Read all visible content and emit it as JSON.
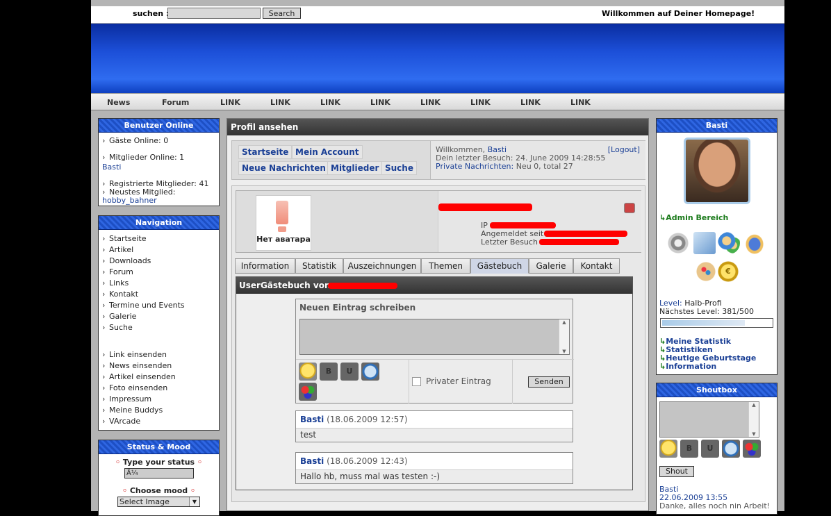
{
  "search": {
    "label": "suchen :",
    "button": "Search"
  },
  "welcome": "Willkommen auf Deiner Homepage!",
  "topnav": [
    "News",
    "Forum",
    "LINK",
    "LINK",
    "LINK",
    "LINK",
    "LINK",
    "LINK",
    "LINK",
    "LINK"
  ],
  "online": {
    "title": "Benutzer Online",
    "guests": "Gäste Online: 0",
    "members": "Mitglieder Online: 1",
    "member_name": "Basti",
    "registered": "Registrierte Mitglieder: 41",
    "newest": "Neustes Mitglied:",
    "newest_name": "hobby_bahner"
  },
  "navigation": {
    "title": "Navigation",
    "items": [
      "Startseite",
      "Artikel",
      "Downloads",
      "Forum",
      "Links",
      "Kontakt",
      "Termine und Events",
      "Galerie",
      "Suche"
    ],
    "items2": [
      "Link einsenden",
      "News einsenden",
      "Artikel einsenden",
      "Foto einsenden",
      "Impressum",
      "Meine Buddys",
      "VArcade"
    ]
  },
  "status": {
    "title": "Status & Mood",
    "type_label": "Type your status",
    "type_value": "Ã¼",
    "mood_label": "Choose mood",
    "mood_value": "Select Image"
  },
  "profile": {
    "title": "Profil ansehen",
    "buttons": [
      "Startseite",
      "Mein Account",
      "Neue Nachrichten",
      "Mitglieder",
      "Suche"
    ],
    "welcome_prefix": "Willkommen,",
    "welcome_name": "Basti",
    "logout": "[Logout]",
    "last_visit": "Dein letzter Besuch: 24. June 2009 14:28:55",
    "pm_label": "Private Nachrichten:",
    "pm_value": "Neu 0, total 27",
    "no_avatar": "Нет аватара",
    "ip_label": "IP",
    "since_label": "Angemeldet seit",
    "last_label": "Letzter Besuch",
    "tabs": [
      "Information",
      "Statistik",
      "Auszeichnungen",
      "Themen",
      "Gästebuch",
      "Galerie",
      "Kontakt"
    ],
    "guestbook_title": "UserGästebuch von",
    "new_entry": "Neuen Eintrag schreiben",
    "private_entry": "Privater Eintrag",
    "send": "Senden",
    "entries": [
      {
        "author": "Basti",
        "date": "(18.06.2009 12:57)",
        "text": "test"
      },
      {
        "author": "Basti",
        "date": "(18.06.2009 12:43)",
        "text": "Hallo hb, muss mal was testen :-)"
      }
    ]
  },
  "user": {
    "name": "Basti",
    "admin": "Admin Bereich",
    "level_label": "Level:",
    "level_value": "Halb-Profi",
    "next_label": "Nächstes Level:",
    "next_value": "381/500",
    "progress": 0.76,
    "links": [
      "Meine Statistik",
      "Statistiken",
      "Heutige Geburtstage",
      "Information"
    ]
  },
  "shoutbox": {
    "title": "Shoutbox",
    "button": "Shout",
    "name": "Basti",
    "date": "22.06.2009 13:55",
    "text": "Danke, alles noch nin Arbeit!"
  }
}
